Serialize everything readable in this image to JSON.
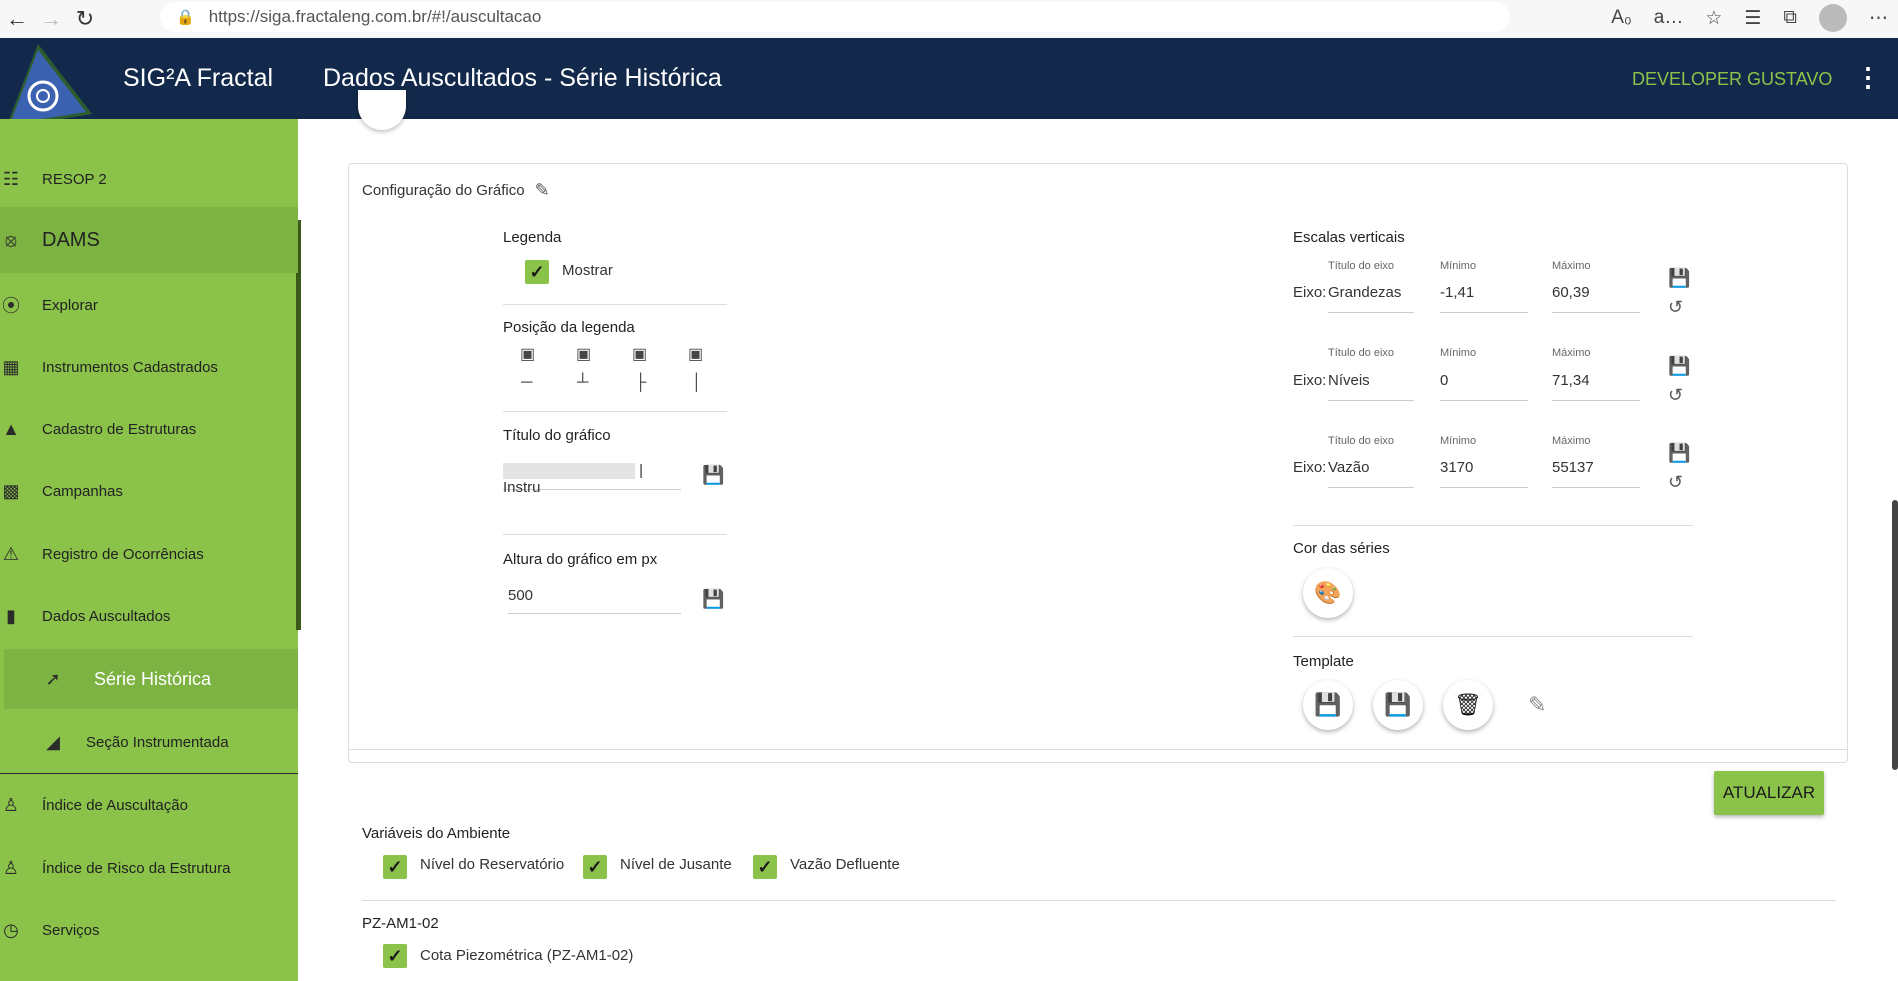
{
  "browser": {
    "url": "https://siga.fractaleng.com.br/#!/auscultacao"
  },
  "header": {
    "app_name": "SIG²A Fractal",
    "page_title": "Dados Auscultados - Série Histórica",
    "user": "DEVELOPER GUSTAVO",
    "bg_color": "#13294b",
    "accent_color": "#8bc34a"
  },
  "sidebar": {
    "items": [
      {
        "label": "RESOP 2",
        "icon": "dam-icon"
      },
      {
        "label": "DAMS",
        "icon": "signal-icon"
      },
      {
        "label": "Explorar",
        "icon": "compass-icon"
      },
      {
        "label": "Instrumentos Cadastrados",
        "icon": "instrument-icon"
      },
      {
        "label": "Cadastro de Estruturas",
        "icon": "shapes-icon"
      },
      {
        "label": "Campanhas",
        "icon": "briefcase-icon"
      },
      {
        "label": "Registro de Ocorrências",
        "icon": "warning-icon"
      },
      {
        "label": "Dados Auscultados",
        "icon": "bar-chart-icon"
      },
      {
        "label": "Série Histórica",
        "icon": "trend-icon"
      },
      {
        "label": "Seção Instrumentada",
        "icon": "section-icon"
      },
      {
        "label": "Índice de Auscultação",
        "icon": "worker-icon"
      },
      {
        "label": "Índice de Risco da Estrutura",
        "icon": "group-icon"
      },
      {
        "label": "Serviços",
        "icon": "clock-icon"
      }
    ]
  },
  "config": {
    "title": "Configuração do Gráfico",
    "legend_label": "Legenda",
    "legend_show": "Mostrar",
    "legend_pos_label": "Posição da legenda",
    "chart_title_label": "Título do gráfico",
    "chart_title_value": "| Instru",
    "height_label": "Altura do gráfico em px",
    "height_value": "500",
    "scales_label": "Escalas verticais",
    "axis_title_lbl": "Título do eixo",
    "min_lbl": "Mínimo",
    "max_lbl": "Máximo",
    "eixo_prefix": "Eixo:",
    "axes": [
      {
        "title": "Grandezas",
        "min": "-1,41",
        "max": "60,39"
      },
      {
        "title": "Níveis",
        "min": "0",
        "max": "71,34"
      },
      {
        "title": "Vazão",
        "min": "3170",
        "max": "55137"
      }
    ],
    "series_color_label": "Cor das séries",
    "template_label": "Template",
    "update_button": "ATUALIZAR"
  },
  "variables": {
    "env_title": "Variáveis do Ambiente",
    "env_items": [
      "Nível do Reservatório",
      "Nível de Jusante",
      "Vazão Defluente"
    ],
    "instrument_title": "PZ-AM1-02",
    "instrument_items": [
      "Cota Piezométrica (PZ-AM1-02)"
    ]
  }
}
